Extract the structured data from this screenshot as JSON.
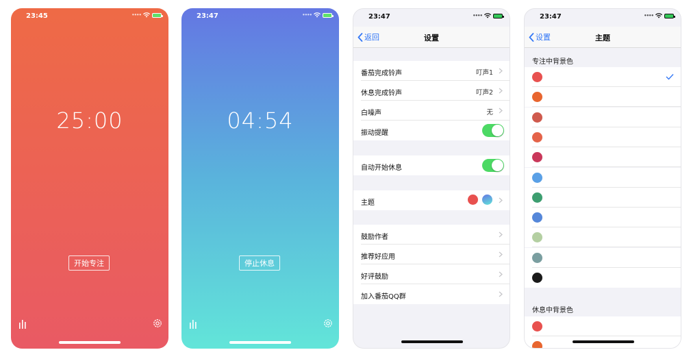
{
  "screen1": {
    "time": "23:45",
    "timer": "25:00",
    "button": "开始专注",
    "colors": {
      "top": "#ee6a46",
      "bottom": "#e95a64"
    }
  },
  "screen2": {
    "time": "23:47",
    "timer": "04:54",
    "button": "停止休息",
    "colors": {
      "top": "#6477e3",
      "bottom": "#62e5d9"
    }
  },
  "screen3": {
    "time": "23:47",
    "back_label": "返回",
    "title": "设置",
    "rows": [
      {
        "label": "番茄完成铃声",
        "value": "叮声1"
      },
      {
        "label": "休息完成铃声",
        "value": "叮声2"
      },
      {
        "label": "白噪声",
        "value": "无"
      },
      {
        "label": "振动提醒",
        "toggle": true
      },
      {
        "label": "自动开始休息",
        "toggle": true
      },
      {
        "label": "主题"
      },
      {
        "label": "鼓励作者"
      },
      {
        "label": "推荐好应用"
      },
      {
        "label": "好评鼓励"
      },
      {
        "label": "加入番茄QQ群"
      }
    ],
    "theme_swatches": [
      "#e8514f",
      "#5c9ee6"
    ]
  },
  "screen4": {
    "time": "23:47",
    "back_label": "设置",
    "title": "主题",
    "focus_header": "专注中背景色",
    "focus_colors": [
      "#e8514f",
      "#e8652f",
      "#cf5a4d",
      "#e46349",
      "#c9385a",
      "#5aa0e6",
      "#3d9e70",
      "#5587d9",
      "#b4cfa2",
      "#7a9ea0",
      "#1a1a1a"
    ],
    "rest_header": "休息中背景色",
    "rest_colors": [
      "#e8514f",
      "#e8652f"
    ]
  },
  "accent": "#3478f6"
}
